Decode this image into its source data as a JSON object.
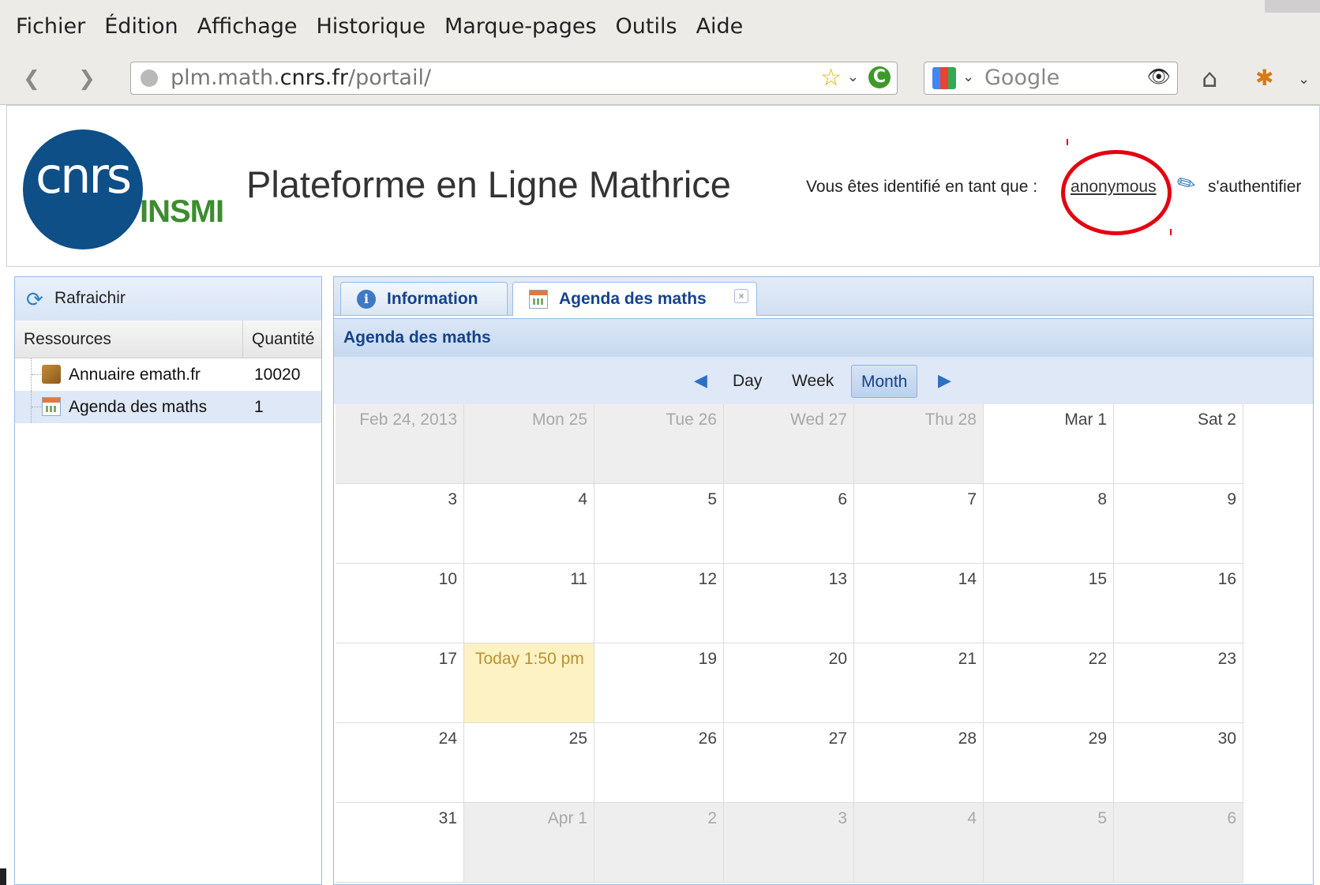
{
  "menu": [
    "Fichier",
    "Édition",
    "Affichage",
    "Historique",
    "Marque-pages",
    "Outils",
    "Aide"
  ],
  "nav": {
    "url_prefix": "plm.math.",
    "url_domain": "cnrs.fr",
    "url_path": "/portail/",
    "search_placeholder": "Google"
  },
  "header": {
    "logo_text": "cnrs",
    "logo_sub": "INSMI",
    "title": "Plateforme en Ligne Mathrice",
    "identity_label": "Vous êtes identifié en tant que :",
    "user": "anonymous",
    "login": "s'authentifier"
  },
  "left_panel": {
    "refresh": "Rafraichir",
    "col_resources": "Ressources",
    "col_quantity": "Quantité",
    "rows": [
      {
        "name": "Annuaire emath.fr",
        "qty": "10020"
      },
      {
        "name": "Agenda des maths",
        "qty": "1"
      }
    ]
  },
  "tabs": [
    {
      "label": "Information"
    },
    {
      "label": "Agenda des maths"
    }
  ],
  "calendar": {
    "title": "Agenda des maths",
    "views": [
      "Day",
      "Week",
      "Month"
    ],
    "active_view": "Month",
    "weeks": [
      [
        {
          "t": "Feb 24, 2013",
          "out": true
        },
        {
          "t": "Mon 25",
          "out": true
        },
        {
          "t": "Tue 26",
          "out": true
        },
        {
          "t": "Wed 27",
          "out": true
        },
        {
          "t": "Thu 28",
          "out": true
        },
        {
          "t": "Mar 1",
          "out": false
        },
        {
          "t": "Sat 2",
          "out": false
        }
      ],
      [
        {
          "t": "3"
        },
        {
          "t": "4"
        },
        {
          "t": "5"
        },
        {
          "t": "6"
        },
        {
          "t": "7"
        },
        {
          "t": "8"
        },
        {
          "t": "9"
        }
      ],
      [
        {
          "t": "10"
        },
        {
          "t": "11"
        },
        {
          "t": "12"
        },
        {
          "t": "13"
        },
        {
          "t": "14"
        },
        {
          "t": "15"
        },
        {
          "t": "16"
        }
      ],
      [
        {
          "t": "17"
        },
        {
          "t": "Today 1:50 pm",
          "today": true
        },
        {
          "t": "19"
        },
        {
          "t": "20"
        },
        {
          "t": "21"
        },
        {
          "t": "22"
        },
        {
          "t": "23"
        }
      ],
      [
        {
          "t": "24"
        },
        {
          "t": "25"
        },
        {
          "t": "26"
        },
        {
          "t": "27"
        },
        {
          "t": "28"
        },
        {
          "t": "29"
        },
        {
          "t": "30"
        }
      ],
      [
        {
          "t": "31"
        },
        {
          "t": "Apr 1",
          "out": true
        },
        {
          "t": "2",
          "out": true
        },
        {
          "t": "3",
          "out": true
        },
        {
          "t": "4",
          "out": true
        },
        {
          "t": "5",
          "out": true
        },
        {
          "t": "6",
          "out": true
        }
      ]
    ]
  }
}
